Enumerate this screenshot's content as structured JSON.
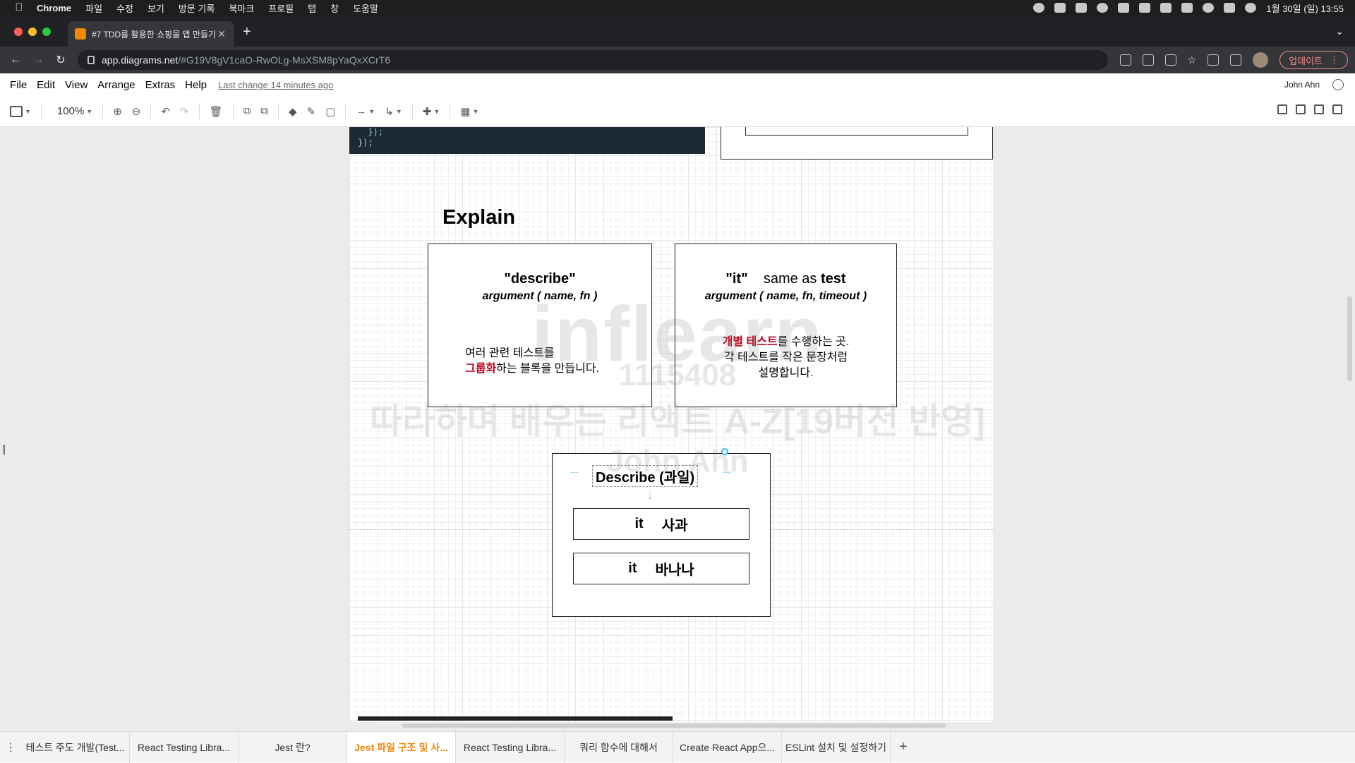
{
  "mac_menubar": {
    "app": "Chrome",
    "items": [
      "파일",
      "수정",
      "보기",
      "방문 기록",
      "북마크",
      "프로필",
      "탭",
      "창",
      "도움말"
    ],
    "clock": "1월 30일 (일) 13:55"
  },
  "browser": {
    "tab_title": "#7 TDD를 활용한 쇼핑몰 앱 만들기",
    "url_host": "app.diagrams.net",
    "url_path": "/#G19V8gV1caO-RwOLg-MsXSM8pYaQxXCrT6",
    "update_label": "업데이트"
  },
  "drawio_menu": {
    "items": [
      "File",
      "Edit",
      "View",
      "Arrange",
      "Extras",
      "Help"
    ],
    "last_change": "Last change 14 minutes ago",
    "user": "John Ahn"
  },
  "toolbar": {
    "zoom": "100%"
  },
  "canvas": {
    "code_lines": [
      "  });",
      "});"
    ],
    "explain_title": "Explain",
    "card_describe": {
      "keyword": "\"describe\"",
      "args": "argument ( name, fn )",
      "desc_line1": "여러 관련 테스트를",
      "desc_highlight": "그룹화",
      "desc_line2_rest": "하는 블록을 만듭니다."
    },
    "card_it": {
      "keyword": "\"it\"",
      "same_as": "same as",
      "test_word": "test",
      "args": "argument ( name, fn, timeout )",
      "desc_highlight": "개별 테스트",
      "desc_line1_rest": "를 수행하는 곳.",
      "desc_line2": "각 테스트를 작은 문장처럼",
      "desc_line3": "설명합니다."
    },
    "describe_box": {
      "label": "Describe (과일)",
      "items": [
        {
          "it": "it",
          "name": "사과"
        },
        {
          "it": "it",
          "name": "바나나"
        }
      ]
    },
    "watermark": {
      "brand": "inflearn",
      "id": "1115408",
      "course": "따라하며 배우는 리액트 A-Z[19버전 반영]",
      "name": "John Ahn"
    }
  },
  "page_tabs": [
    {
      "label": "테스트 주도 개발(Test...",
      "active": false
    },
    {
      "label": "React Testing Libra...",
      "active": false
    },
    {
      "label": "Jest 란?",
      "active": false
    },
    {
      "label": "Jest 파일 구조 및 사...",
      "active": true
    },
    {
      "label": "React Testing Libra...",
      "active": false
    },
    {
      "label": "쿼리 함수에 대해서",
      "active": false
    },
    {
      "label": "Create React App으...",
      "active": false
    },
    {
      "label": "ESLint 설치 및 설정하기",
      "active": false
    }
  ]
}
